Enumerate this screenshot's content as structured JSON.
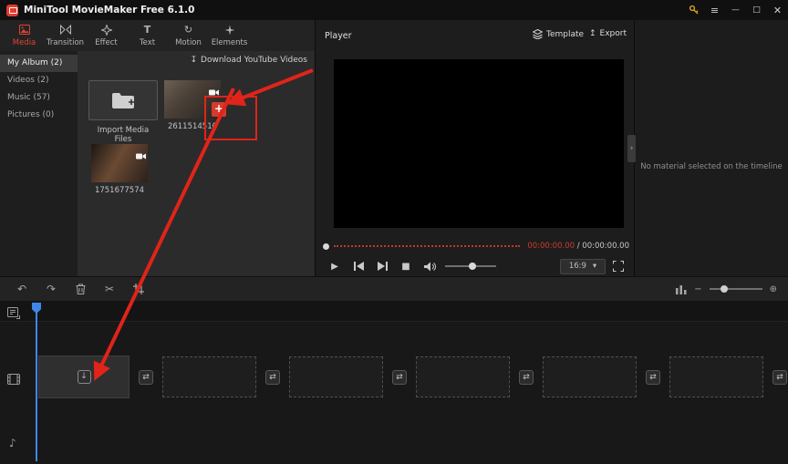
{
  "window": {
    "title": "MiniTool MovieMaker Free 6.1.0"
  },
  "tabs": [
    {
      "label": "Media",
      "active": true
    },
    {
      "label": "Transition",
      "active": false
    },
    {
      "label": "Effect",
      "active": false
    },
    {
      "label": "Text",
      "active": false
    },
    {
      "label": "Motion",
      "active": false
    },
    {
      "label": "Elements",
      "active": false
    }
  ],
  "sidebar": {
    "items": [
      {
        "label": "My Album (2)",
        "active": true
      },
      {
        "label": "Videos (2)",
        "active": false
      },
      {
        "label": "Music (57)",
        "active": false
      },
      {
        "label": "Pictures (0)",
        "active": false
      }
    ]
  },
  "media": {
    "download_label": "Download YouTube Videos",
    "import_label": "Import Media Files",
    "add_label": "+",
    "items": [
      {
        "name": "2611514510"
      },
      {
        "name": "1751677574"
      }
    ]
  },
  "player": {
    "title": "Player",
    "template_label": "Template",
    "export_label": "Export",
    "current_time": "00:00:00.00",
    "time_separator": " / ",
    "total_time": "00:00:00.00",
    "aspect_ratio": "16:9"
  },
  "properties_panel": {
    "empty_text": "No material selected on the timeline"
  },
  "glyphs": {
    "menu": "≡",
    "minimize": "—",
    "maximize": "□",
    "close": "✕",
    "undo": "↶",
    "redo": "↷",
    "scissors": "✂",
    "download": "↧",
    "export": "↥",
    "play": "▶",
    "stop": "■",
    "chevron_down": "▾",
    "collapse": "›",
    "swap": "⇄",
    "drop": "↓",
    "note": "♪",
    "zoom_minus": "−",
    "zoom_plus": "⊕"
  },
  "colors": {
    "accent_red": "#e33b2e",
    "annotation_red": "#e02419",
    "playhead_blue": "#3f86e8",
    "key_gold": "#d7a021",
    "time_red": "#d03a2e"
  }
}
